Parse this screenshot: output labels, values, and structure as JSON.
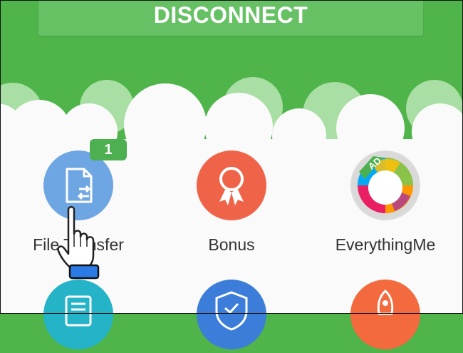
{
  "header": {
    "disconnect_label": "DISCONNECT"
  },
  "apps": [
    {
      "label": "File Transfer",
      "icon": "file-transfer-icon",
      "color": "#6ea6e4",
      "badge": "1"
    },
    {
      "label": "Bonus",
      "icon": "ribbon-award-icon",
      "color": "#ef6448"
    },
    {
      "label": "EverythingMe",
      "icon": "everythingme-logo-icon",
      "ad_label": "AD"
    }
  ],
  "second_row": [
    {
      "icon": "document-icon",
      "color": "#25b3c8"
    },
    {
      "icon": "shield-check-icon",
      "color": "#3b7dd8"
    },
    {
      "icon": "rocket-icon",
      "color": "#f26a3d"
    }
  ],
  "colors": {
    "background": "#4fb54a",
    "panel": "#fafafa",
    "badge": "#4caf50"
  }
}
